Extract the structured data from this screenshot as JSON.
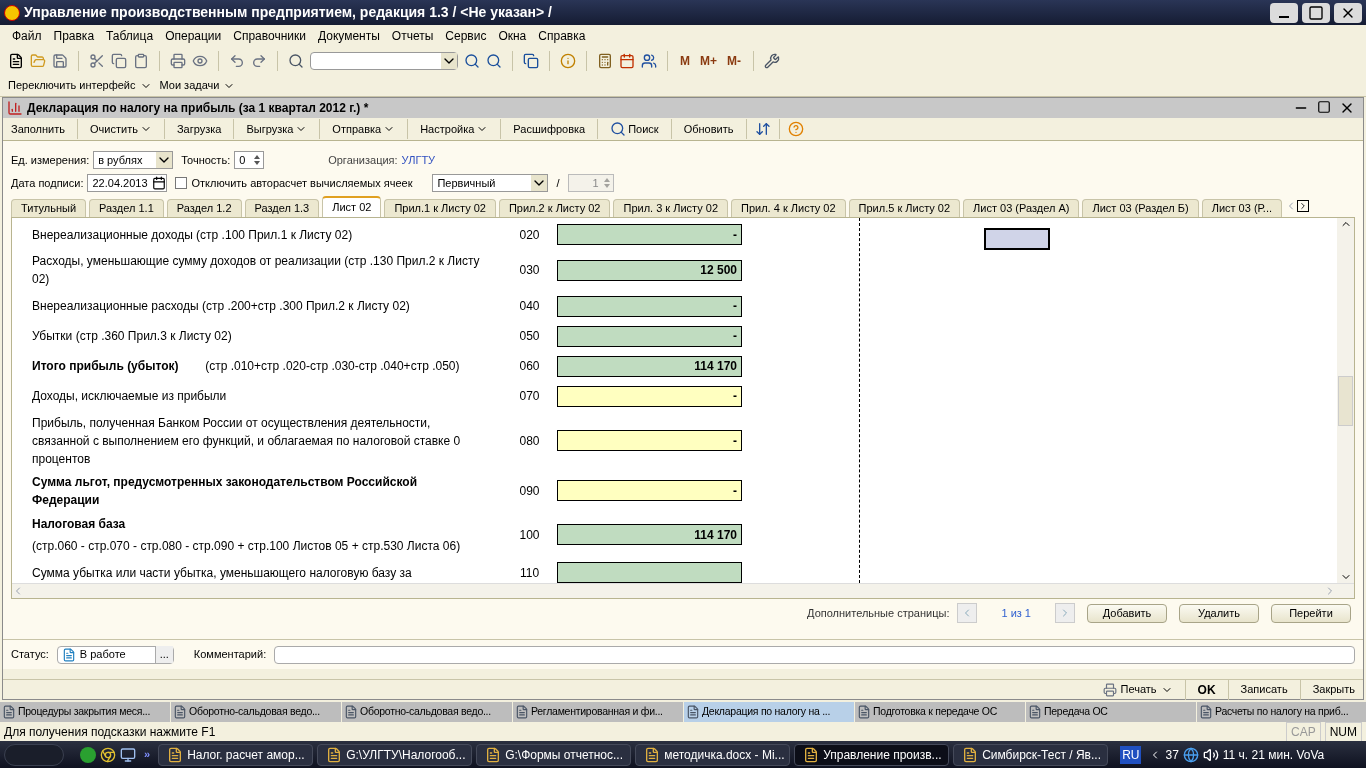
{
  "window": {
    "title": "Управление производственным предприятием, редакция 1.3 / <Не указан> /"
  },
  "menu": [
    "Файл",
    "Правка",
    "Таблица",
    "Операции",
    "Справочники",
    "Документы",
    "Отчеты",
    "Сервис",
    "Окна",
    "Справка"
  ],
  "toolbar": {
    "memory_buttons": [
      "M",
      "M+",
      "M-"
    ]
  },
  "panel_bar": [
    "Переключить интерфейс",
    "Мои задачи"
  ],
  "document": {
    "title": "Декларация по налогу на прибыль (за 1 квартал 2012 г.) *",
    "commands": [
      {
        "label": "Заполнить",
        "dropdown": false
      },
      {
        "label": "Очистить",
        "dropdown": true
      },
      {
        "label": "Загрузка",
        "dropdown": false
      },
      {
        "label": "Выгрузка",
        "dropdown": true
      },
      {
        "label": "Отправка",
        "dropdown": true
      },
      {
        "label": "Настройка",
        "dropdown": true
      },
      {
        "label": "Расшифровка",
        "dropdown": false
      },
      {
        "label": "Поиск",
        "dropdown": false
      },
      {
        "label": "Обновить",
        "dropdown": false
      }
    ],
    "unit_label": "Ед. измерения:",
    "unit_value": "в рублях",
    "precision_label": "Точность:",
    "precision_value": "0",
    "org_label": "Организация:",
    "org_value": "УЛГТУ",
    "date_label": "Дата подписи:",
    "date_value": "22.04.2013",
    "autocalc": {
      "label": "Отключить авторасчет вычисляемых ячеек",
      "checked": false
    },
    "report_type": "Первичный",
    "slash": "/",
    "correction": "1",
    "tabs": [
      {
        "label": "Титульный",
        "selected": false
      },
      {
        "label": "Раздел 1.1",
        "selected": false
      },
      {
        "label": "Раздел 1.2",
        "selected": false
      },
      {
        "label": "Раздел 1.3",
        "selected": false
      },
      {
        "label": "Лист 02",
        "selected": true
      },
      {
        "label": "Прил.1 к Листу 02",
        "selected": false
      },
      {
        "label": "Прил.2 к Листу 02",
        "selected": false
      },
      {
        "label": "Прил. 3 к Листу 02",
        "selected": false
      },
      {
        "label": "Прил. 4 к Листу 02",
        "selected": false
      },
      {
        "label": "Прил.5 к Листу 02",
        "selected": false
      },
      {
        "label": "Лист 03 (Раздел А)",
        "selected": false
      },
      {
        "label": "Лист 03 (Раздел Б)",
        "selected": false
      },
      {
        "label": "Лист 03 (Р...",
        "selected": false
      }
    ],
    "rows": [
      {
        "label": "Внереализационные доходы (стр .100 Прил.1 к Листу 02)",
        "emphasis": false,
        "code": "020",
        "kind": "computed",
        "value": "-"
      },
      {
        "label": "Расходы, уменьшающие сумму доходов от реализации (стр .130 Прил.2 к Листу 02)",
        "emphasis": false,
        "code": "030",
        "kind": "computed",
        "value": "12 500"
      },
      {
        "label": "Внереализационные расходы (стр .200+стр .300 Прил.2 к Листу 02)",
        "emphasis": false,
        "code": "040",
        "kind": "computed",
        "value": "-"
      },
      {
        "label": "Убытки (стр .360 Прил.3 к Листу 02)",
        "emphasis": false,
        "code": "050",
        "kind": "computed",
        "value": "-"
      },
      {
        "label": "**Итого прибыль (убыток)**        (стр .010+стр .020-стр .030-стр .040+стр .050)",
        "emphasis": false,
        "code": "060",
        "kind": "computed",
        "value": "114 170"
      },
      {
        "label": "Доходы, исключаемые из прибыли",
        "emphasis": false,
        "code": "070",
        "kind": "input",
        "value": "-"
      },
      {
        "label": "Прибыль, полученная Банком России от осуществления деятельности, связанной с выполнением его функций, и облагаемая по налоговой ставке 0 процентов",
        "emphasis": false,
        "code": "080",
        "kind": "input",
        "value": "-"
      },
      {
        "label": "Сумма льгот, предусмотренных законодательством Российской Федерации",
        "emphasis": true,
        "code": "090",
        "kind": "input",
        "value": "-"
      },
      {
        "label": "Налоговая база",
        "note": "(стр.060 - стр.070 - стр.080 - стр.090 + стр.100 Листов 05 + стр.530 Листа 06)",
        "emphasis": true,
        "code": "100",
        "kind": "computed",
        "value": "114 170"
      },
      {
        "label": "Сумма убытка или части убытка, уменьшающего налоговую базу за",
        "emphasis": false,
        "code": "110",
        "kind": "computed"
      }
    ],
    "extra_pages_label": "Дополнительные страницы:",
    "extra_pages_count": "1 из 1",
    "page_buttons": [
      "Добавить",
      "Удалить",
      "Перейти"
    ],
    "status_label": "Статус:",
    "status_value": "В работе",
    "status_more": "...",
    "comment_label": "Комментарий:",
    "footer": {
      "print": "Печать",
      "ok": "OK",
      "save": "Записать",
      "close": "Закрыть"
    }
  },
  "window_tabs": [
    {
      "label": "Процедуры закрытия меся...",
      "selected": false
    },
    {
      "label": "Оборотно-сальдовая ведо...",
      "selected": false
    },
    {
      "label": "Оборотно-сальдовая ведо...",
      "selected": false
    },
    {
      "label": "Регламентированная и фи...",
      "selected": false
    },
    {
      "label": "Декларация по налогу на ...",
      "selected": true
    },
    {
      "label": "Подготовка к передаче ОС",
      "selected": false
    },
    {
      "label": "Передача ОС",
      "selected": false
    },
    {
      "label": "Расчеты по налогу на приб...",
      "selected": false
    }
  ],
  "status_bar": {
    "hint": "Для получения подсказки нажмите F1",
    "caps": "CAP",
    "num": "NUM"
  },
  "taskbar": {
    "more": "»",
    "tasks": [
      {
        "label": "Налог. расчет амор...",
        "selected": false
      },
      {
        "label": "G:\\УЛГТУ\\Налогооб...",
        "selected": false
      },
      {
        "label": "G:\\Формы отчетнос...",
        "selected": false
      },
      {
        "label": "методичка.docx - Mi...",
        "selected": false
      },
      {
        "label": "Управление произв...",
        "selected": true
      },
      {
        "label": "Симбирск-Тест / Яв...",
        "selected": false
      }
    ],
    "language": "RU",
    "tray_count": "37",
    "clock": "11 ч. 21 мин. VoVa"
  }
}
